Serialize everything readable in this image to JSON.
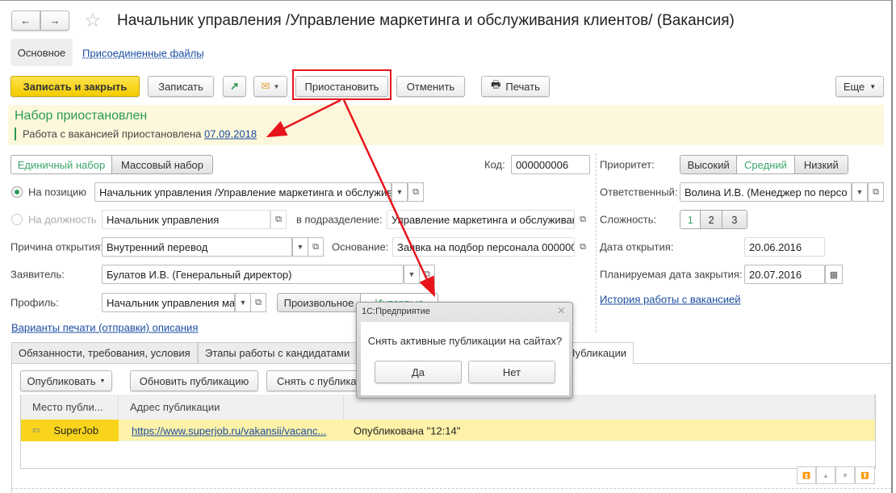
{
  "window": {
    "title": "Начальник управления /Управление маркетинга и обслуживания клиентов/ (Вакансия)"
  },
  "nav": {
    "back": "←",
    "forward": "→",
    "star": "☆"
  },
  "sections": {
    "main": "Основное",
    "files": "Присоединенные файлы"
  },
  "toolbar": {
    "save_close": "Записать и закрыть",
    "save": "Записать",
    "suspend": "Приостановить",
    "cancel": "Отменить",
    "print": "Печать",
    "more": "Еще"
  },
  "banner": {
    "title": "Набор приостановлен",
    "text": "Работа с вакансией приостановлена",
    "date": "07.09.2018"
  },
  "form": {
    "mode": [
      "Единичный набор",
      "Массовый набор"
    ],
    "code_label": "Код:",
    "code": "000000006",
    "on_position": "На позицию",
    "position": "Начальник управления /Управление маркетинга и обслужив",
    "on_post": "На должность",
    "post": "Начальник управления",
    "dept_label": "в подразделение:",
    "dept": "Управление маркетинга и обслуживан",
    "reason_label": "Причина открытия:",
    "reason": "Внутренний перевод",
    "basis_label": "Основание:",
    "basis": "Заявка на подбор персонала 000000",
    "applicant_label": "Заявитель:",
    "applicant": "Булатов И.В. (Генеральный директор)",
    "profile_label": "Профиль:",
    "profile": "Начальник управления ма",
    "profile_mode": [
      "Произвольное",
      "Интервью"
    ],
    "print_link": "Варианты печати (отправки) описания"
  },
  "right": {
    "priority_label": "Приоритет:",
    "priority": [
      "Высокий",
      "Средний",
      "Низкий"
    ],
    "priority_selected": "Средний",
    "responsible_label": "Ответственный:",
    "responsible": "Волина И.В. (Менеджер по персо",
    "complexity_label": "Сложность:",
    "complexity": [
      "1",
      "2",
      "3"
    ],
    "complexity_selected": "1",
    "open_date_label": "Дата открытия:",
    "open_date": "20.06.2016",
    "close_date_label": "Планируемая дата закрытия:",
    "close_date": "20.07.2016",
    "history_link": "История работы с вакансией"
  },
  "tabs": [
    "Обязанности, требования, условия",
    "Этапы работы с кандидатами",
    "Публикации"
  ],
  "pub": {
    "publish": "Опубликовать",
    "update": "Обновить публикацию",
    "remove": "Снять с публикации",
    "columns": [
      "Место публи...",
      "Адрес публикации",
      ""
    ],
    "rows": [
      {
        "site": "SuperJob",
        "url": "https://www.superjob.ru/vakansii/vacanc...",
        "status": "Опубликована \"12:14\""
      }
    ]
  },
  "dialog": {
    "title": "1С:Предприятие",
    "message": "Снять активные публикации на сайтах?",
    "yes": "Да",
    "no": "Нет",
    "close": "×"
  },
  "colors": {
    "accent_green": "#3aa56a",
    "link": "#1a4ca0",
    "highlight": "#fdf2a8",
    "annotation": "#e8141b"
  }
}
